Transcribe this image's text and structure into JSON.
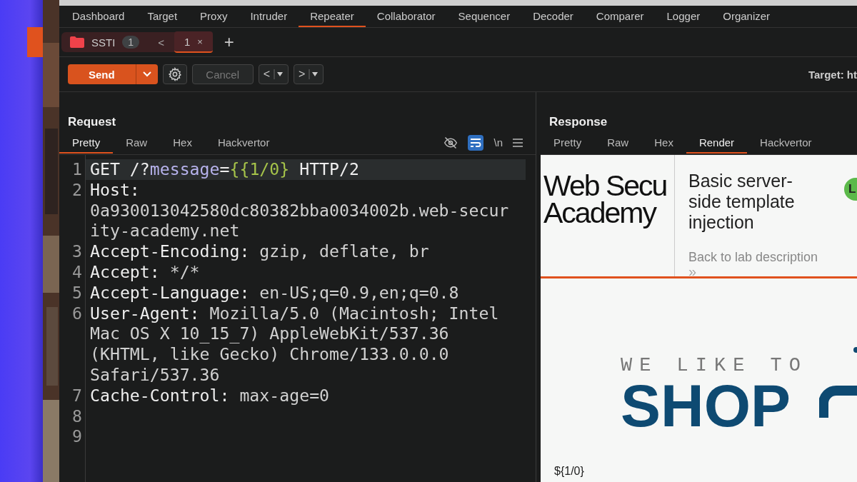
{
  "nav_tabs": [
    {
      "label": "Dashboard",
      "selected": false
    },
    {
      "label": "Target",
      "selected": false
    },
    {
      "label": "Proxy",
      "selected": false
    },
    {
      "label": "Intruder",
      "selected": false
    },
    {
      "label": "Repeater",
      "selected": true
    },
    {
      "label": "Collaborator",
      "selected": false
    },
    {
      "label": "Sequencer",
      "selected": false
    },
    {
      "label": "Decoder",
      "selected": false
    },
    {
      "label": "Comparer",
      "selected": false
    },
    {
      "label": "Logger",
      "selected": false
    },
    {
      "label": "Organizer",
      "selected": false
    }
  ],
  "repeater_tabs": {
    "group": {
      "label": "SSTI",
      "count": "1",
      "collapse": "<"
    },
    "tabs": [
      {
        "label": "1",
        "close": "×",
        "selected": true
      }
    ],
    "add": "+"
  },
  "toolbar": {
    "send": "Send",
    "cancel": {
      "label": "Cancel",
      "disabled": true
    },
    "back": "<",
    "forward": ">",
    "target": "Target: ht"
  },
  "request": {
    "title": "Request",
    "tabs": [
      {
        "label": "Pretty",
        "selected": true
      },
      {
        "label": "Raw",
        "selected": false
      },
      {
        "label": "Hex",
        "selected": false
      },
      {
        "label": "Hackvertor",
        "selected": false
      }
    ],
    "wrap_on": true,
    "newline_toggle": "\\n",
    "lines": [
      {
        "number": "1",
        "current": true,
        "rows": [
          [
            {
              "text": "GET /?",
              "kind": "plain"
            },
            {
              "text": "message",
              "kind": "param"
            },
            {
              "text": "=",
              "kind": "plain"
            },
            {
              "text": "{{1/0}",
              "kind": "payload"
            },
            {
              "text": " HTTP/2",
              "kind": "plain"
            }
          ]
        ]
      },
      {
        "number": "2",
        "current": false,
        "rows": [
          [
            {
              "text": "Host:",
              "kind": "name"
            }
          ],
          [
            {
              "text": "0a930013042580dc80382bba0034002b.web-secur",
              "kind": "value"
            }
          ],
          [
            {
              "text": "ity-academy.net",
              "kind": "value"
            }
          ]
        ]
      },
      {
        "number": "3",
        "current": false,
        "rows": [
          [
            {
              "text": "Accept-Encoding:",
              "kind": "name"
            },
            {
              "text": " gzip, deflate, br",
              "kind": "value"
            }
          ]
        ]
      },
      {
        "number": "4",
        "current": false,
        "rows": [
          [
            {
              "text": "Accept:",
              "kind": "name"
            },
            {
              "text": " */*",
              "kind": "value"
            }
          ]
        ]
      },
      {
        "number": "5",
        "current": false,
        "rows": [
          [
            {
              "text": "Accept-Language:",
              "kind": "name"
            },
            {
              "text": " en-US;q=0.9,en;q=0.8",
              "kind": "value"
            }
          ]
        ]
      },
      {
        "number": "6",
        "current": false,
        "rows": [
          [
            {
              "text": "User-Agent:",
              "kind": "name"
            },
            {
              "text": " Mozilla/5.0 (Macintosh; Intel",
              "kind": "value"
            }
          ],
          [
            {
              "text": "Mac OS X 10_15_7) AppleWebKit/537.36",
              "kind": "value"
            }
          ],
          [
            {
              "text": "(KHTML, like Gecko) Chrome/133.0.0.0",
              "kind": "value"
            }
          ],
          [
            {
              "text": "Safari/537.36",
              "kind": "value"
            }
          ]
        ]
      },
      {
        "number": "7",
        "current": false,
        "rows": [
          [
            {
              "text": "Cache-Control:",
              "kind": "name"
            },
            {
              "text": " max-age=0",
              "kind": "value"
            }
          ]
        ]
      },
      {
        "number": "8",
        "current": false,
        "rows": [
          []
        ]
      },
      {
        "number": "9",
        "current": false,
        "rows": [
          []
        ]
      }
    ]
  },
  "response": {
    "title": "Response",
    "tabs": [
      {
        "label": "Pretty",
        "selected": false
      },
      {
        "label": "Raw",
        "selected": false
      },
      {
        "label": "Hex",
        "selected": false
      },
      {
        "label": "Render",
        "selected": true
      },
      {
        "label": "Hackvertor",
        "selected": false
      }
    ],
    "render": {
      "logo": [
        "Web Secu",
        "Academy"
      ],
      "lab_title": "Basic server-side template injection",
      "status_badge": "L",
      "back_link": "Back to lab description",
      "back_arrows": "»",
      "hero_small": "WE LIKE TO",
      "hero_big": "SHOP",
      "output": "${1/0}"
    }
  }
}
